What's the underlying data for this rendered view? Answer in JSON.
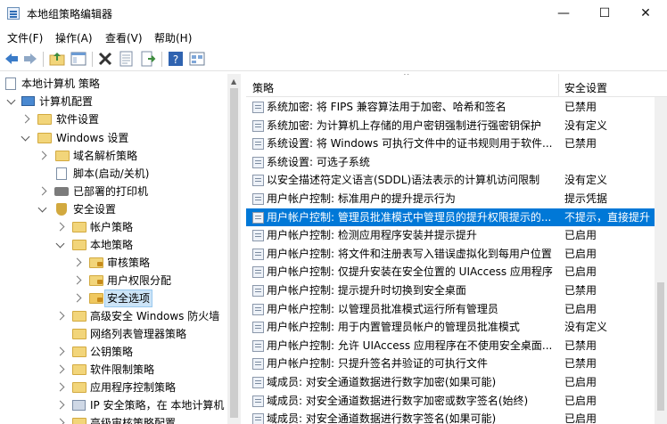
{
  "window": {
    "title": "本地组策略编辑器",
    "controls": {
      "minimize": "—",
      "maximize": "☐",
      "close": "✕"
    }
  },
  "menu": [
    "文件(F)",
    "操作(A)",
    "查看(V)",
    "帮助(H)"
  ],
  "toolbar_icons": [
    "back-arrow-icon",
    "forward-arrow-icon",
    "up-folder-icon",
    "show-hide-tree-icon",
    "delete-icon",
    "properties-icon",
    "export-list-icon",
    "help-icon",
    "view-icon"
  ],
  "tree": {
    "root": "本地计算机 策略",
    "items": [
      {
        "label": "计算机配置"
      },
      {
        "label": "软件设置"
      },
      {
        "label": "Windows 设置"
      },
      {
        "label": "域名解析策略"
      },
      {
        "label": "脚本(启动/关机)"
      },
      {
        "label": "已部署的打印机"
      },
      {
        "label": "安全设置"
      },
      {
        "label": "帐户策略"
      },
      {
        "label": "本地策略"
      },
      {
        "label": "审核策略"
      },
      {
        "label": "用户权限分配"
      },
      {
        "label": "安全选项"
      },
      {
        "label": "高级安全 Windows 防火墙"
      },
      {
        "label": "网络列表管理器策略"
      },
      {
        "label": "公钥策略"
      },
      {
        "label": "软件限制策略"
      },
      {
        "label": "应用程序控制策略"
      },
      {
        "label": "IP 安全策略，在 本地计算机"
      },
      {
        "label": "高级审核策略配置"
      }
    ]
  },
  "list": {
    "columns": [
      "策略",
      "安全设置"
    ],
    "rows": [
      {
        "name": "系统加密: 将 FIPS 兼容算法用于加密、哈希和签名",
        "value": "已禁用"
      },
      {
        "name": "系统加密: 为计算机上存储的用户密钥强制进行强密钥保护",
        "value": "没有定义"
      },
      {
        "name": "系统设置: 将 Windows 可执行文件中的证书规则用于软件...",
        "value": "已禁用"
      },
      {
        "name": "系统设置: 可选子系统",
        "value": ""
      },
      {
        "name": "以安全描述符定义语言(SDDL)语法表示的计算机访问限制",
        "value": "没有定义"
      },
      {
        "name": "用户帐户控制: 标准用户的提升提示行为",
        "value": "提示凭据"
      },
      {
        "name": "用户帐户控制: 管理员批准模式中管理员的提升权限提示的...",
        "value": "不提示，直接提升"
      },
      {
        "name": "用户帐户控制: 检测应用程序安装并提示提升",
        "value": "已启用"
      },
      {
        "name": "用户帐户控制: 将文件和注册表写入错误虚拟化到每用户位置",
        "value": "已启用"
      },
      {
        "name": "用户帐户控制: 仅提升安装在安全位置的 UIAccess 应用程序",
        "value": "已启用"
      },
      {
        "name": "用户帐户控制: 提示提升时切换到安全桌面",
        "value": "已禁用"
      },
      {
        "name": "用户帐户控制: 以管理员批准模式运行所有管理员",
        "value": "已启用"
      },
      {
        "name": "用户帐户控制: 用于内置管理员帐户的管理员批准模式",
        "value": "没有定义"
      },
      {
        "name": "用户帐户控制: 允许 UIAccess 应用程序在不使用安全桌面...",
        "value": "已禁用"
      },
      {
        "name": "用户帐户控制: 只提升签名并验证的可执行文件",
        "value": "已禁用"
      },
      {
        "name": "域成员: 对安全通道数据进行数字加密(如果可能)",
        "value": "已启用"
      },
      {
        "name": "域成员: 对安全通道数据进行数字加密或数字签名(始终)",
        "value": "已启用"
      },
      {
        "name": "域成员: 对安全通道数据进行数字签名(如果可能)",
        "value": "已启用"
      }
    ],
    "selected_index": 6
  },
  "colors": {
    "selection": "#0078d7",
    "tree_selection": "#cce4f7"
  }
}
